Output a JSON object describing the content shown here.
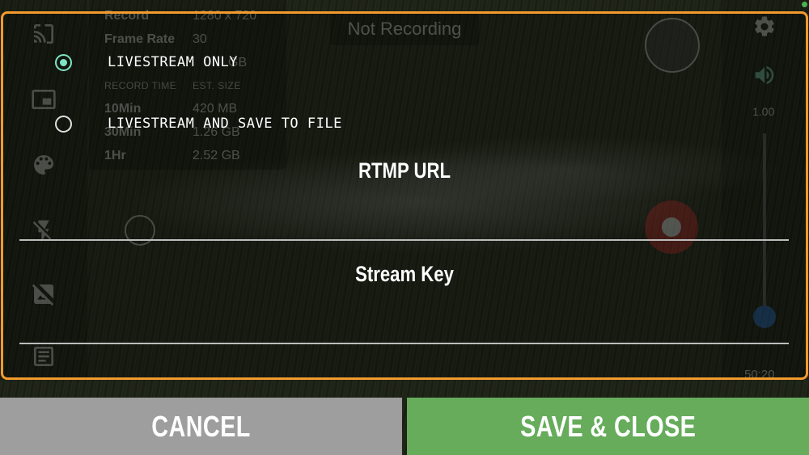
{
  "background": {
    "record_info": {
      "rows": [
        {
          "label": "Record",
          "value": "1280 x 720"
        },
        {
          "label": "Frame Rate",
          "value": "30"
        }
      ],
      "free_space_partial": "GB",
      "table_headers": [
        "RECORD TIME",
        "EST. SIZE"
      ],
      "table_rows": [
        {
          "time": "10Min",
          "size": "420 MB"
        },
        {
          "time": "30Min",
          "size": "1.26 GB"
        },
        {
          "time": "1Hr",
          "size": "2.52 GB"
        }
      ]
    },
    "status_pill": "Not Recording",
    "zoom_value": "1.00",
    "timer": "50:20"
  },
  "dialog": {
    "options": [
      {
        "label": "Livestream Only",
        "selected": true
      },
      {
        "label": "Livestream and Save to File",
        "selected": false
      }
    ],
    "rtmp_url_label": "RTMP URL",
    "stream_key_label": "Stream Key",
    "accent_color": "#f39a2e",
    "radio_color": "#7fe3c6"
  },
  "buttons": {
    "cancel": "CANCEL",
    "save": "SAVE & CLOSE",
    "cancel_color": "#9e9e9e",
    "save_color": "#66ac5b"
  },
  "icons": [
    "cast-icon",
    "picture-in-picture-icon",
    "palette-icon",
    "flash-off-icon",
    "image-off-icon",
    "notes-icon",
    "settings-gear-icon",
    "volume-icon"
  ]
}
